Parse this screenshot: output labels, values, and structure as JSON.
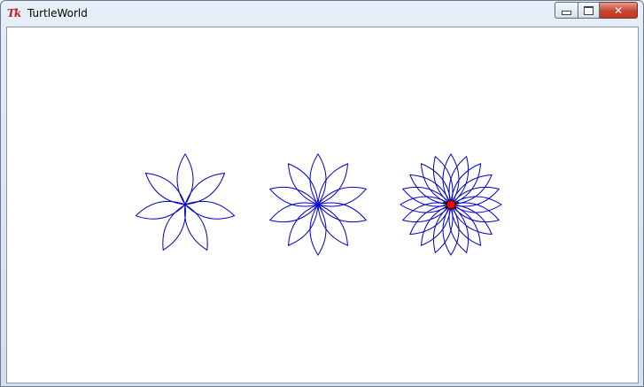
{
  "window": {
    "title": "TurtleWorld",
    "icon": "tk-feather-icon",
    "icon_text": "Tk",
    "controls": [
      "minimize",
      "maximize",
      "close"
    ]
  },
  "canvas": {
    "background": "#ffffff",
    "stroke_color": "#0000cc",
    "flowers": [
      {
        "petals": 7
      },
      {
        "petals": 10
      },
      {
        "petals": 20
      }
    ],
    "turtle": {
      "color": "#ff0000",
      "outline": "#000000"
    }
  }
}
